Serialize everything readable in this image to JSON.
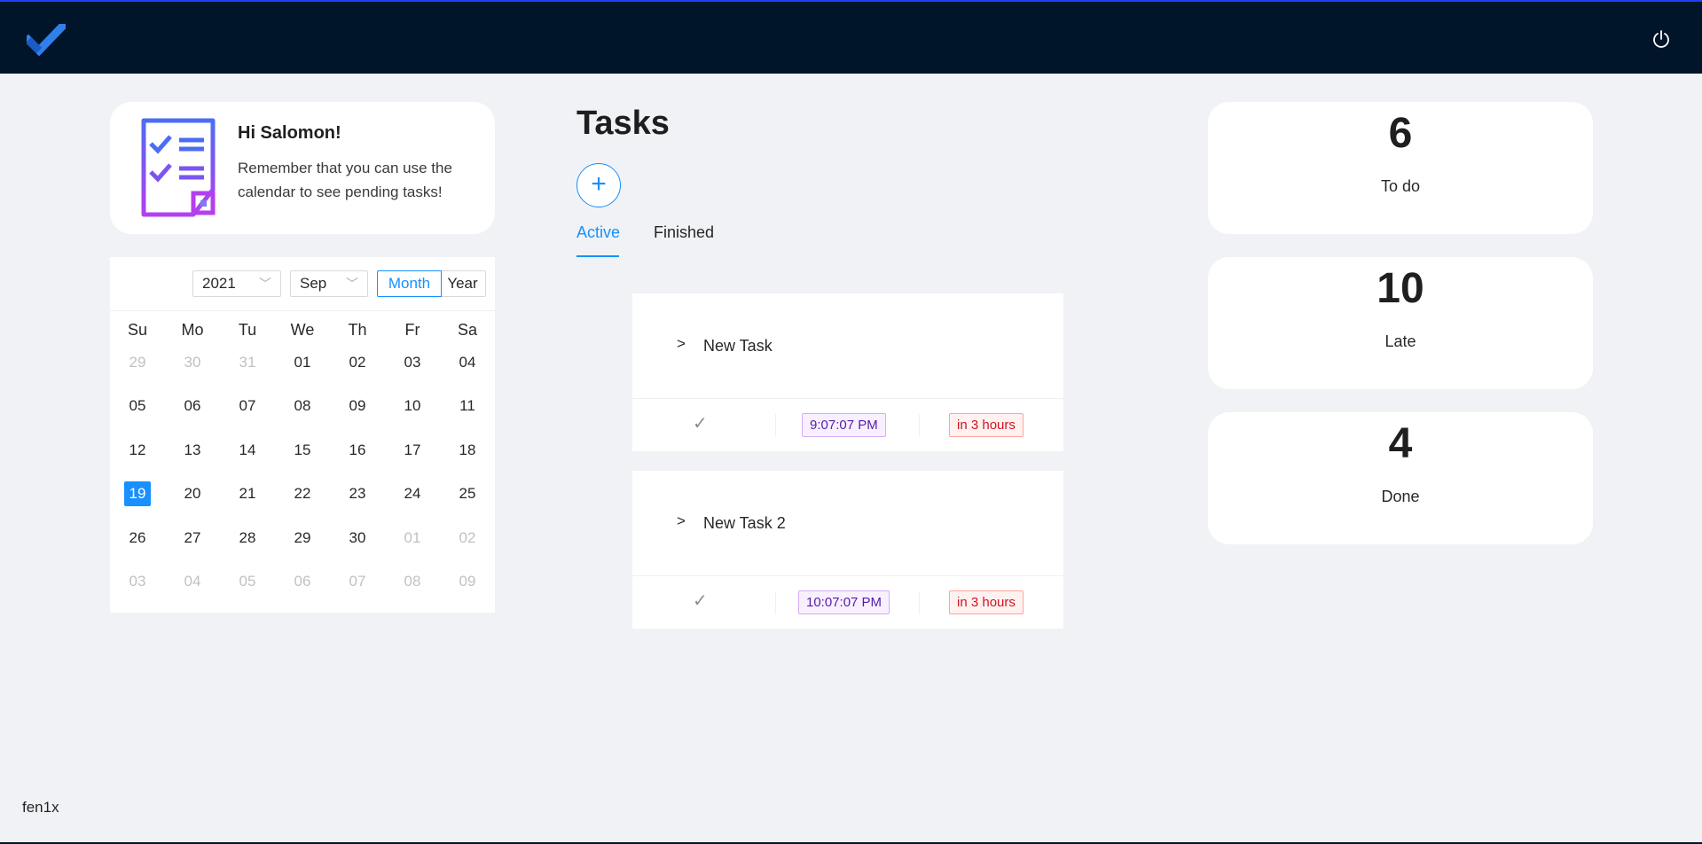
{
  "header": {
    "logo_icon": "checkmark-logo-icon",
    "power_icon": "power-icon"
  },
  "greeting": {
    "title": "Hi Salomon!",
    "text": "Remember that you can use the calendar to see pending tasks!",
    "icon": "checklist-icon"
  },
  "calendar": {
    "year": "2021",
    "month": "Sep",
    "mode_month": "Month",
    "mode_year": "Year",
    "weekdays": [
      "Su",
      "Mo",
      "Tu",
      "We",
      "Th",
      "Fr",
      "Sa"
    ],
    "weeks": [
      [
        "29",
        "30",
        "31",
        "01",
        "02",
        "03",
        "04"
      ],
      [
        "05",
        "06",
        "07",
        "08",
        "09",
        "10",
        "11"
      ],
      [
        "12",
        "13",
        "14",
        "15",
        "16",
        "17",
        "18"
      ],
      [
        "19",
        "20",
        "21",
        "22",
        "23",
        "24",
        "25"
      ],
      [
        "26",
        "27",
        "28",
        "29",
        "30",
        "01",
        "02"
      ],
      [
        "03",
        "04",
        "05",
        "06",
        "07",
        "08",
        "09"
      ]
    ],
    "selected": "19"
  },
  "tasks": {
    "title": "Tasks",
    "add_icon": "plus-icon",
    "tabs": [
      "Active",
      "Finished"
    ],
    "items": [
      {
        "name": "New Task",
        "time": "9:07:07 PM",
        "due": "in 3 hours"
      },
      {
        "name": "New Task 2",
        "time": "10:07:07 PM",
        "due": "in 3 hours"
      }
    ]
  },
  "stats": [
    {
      "value": "6",
      "label": "To do"
    },
    {
      "value": "10",
      "label": "Late"
    },
    {
      "value": "4",
      "label": "Done"
    }
  ],
  "footer": {
    "text": "fen1x"
  },
  "colors": {
    "header": "#001529",
    "accent": "#1890ff",
    "background": "#f0f2f5"
  }
}
